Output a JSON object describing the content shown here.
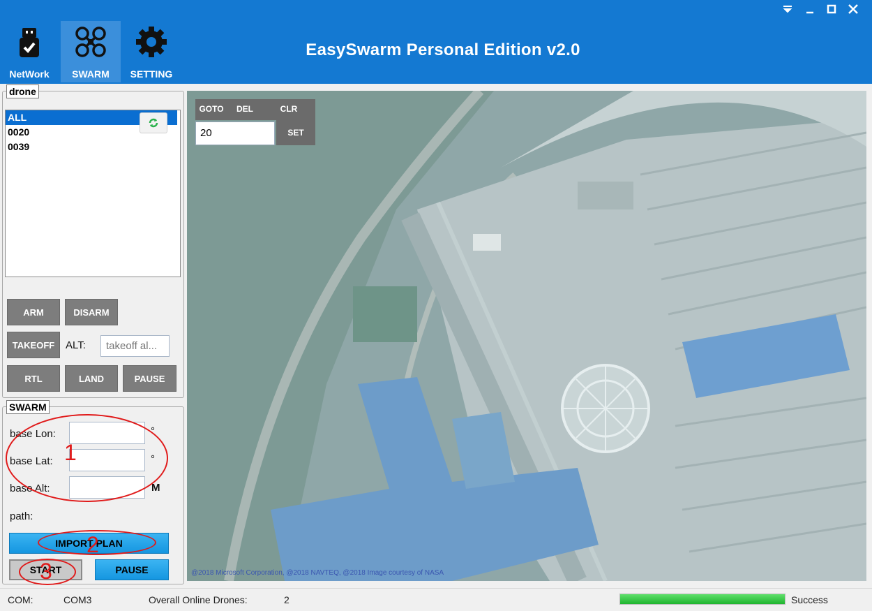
{
  "header": {
    "title": "EasySwarm Personal Edition v2.0",
    "nav": [
      {
        "label": "NetWork",
        "icon": "usb-drive-icon"
      },
      {
        "label": "SWARM",
        "icon": "drone-icon",
        "active": true
      },
      {
        "label": "SETTING",
        "icon": "gear-icon"
      }
    ],
    "window_controls": [
      "dropdown-icon",
      "minimize-icon",
      "maximize-icon",
      "close-icon"
    ],
    "bg_color": "#1479d2"
  },
  "drone_panel": {
    "title": "drone",
    "list": [
      "ALL",
      "0020",
      "0039"
    ],
    "selected_index": 0,
    "refresh_icon": "refresh-icon",
    "arm_label": "ARM",
    "disarm_label": "DISARM",
    "takeoff_label": "TAKEOFF",
    "alt_label": "ALT:",
    "alt_placeholder": "takeoff al...",
    "rtl_label": "RTL",
    "land_label": "LAND",
    "pause_label": "PAUSE"
  },
  "swarm_panel": {
    "title": "SWARM",
    "base_lon_label": "base Lon:",
    "base_lat_label": "base Lat:",
    "base_alt_label": "base Alt:",
    "degree_unit": "°",
    "meter_unit": "M",
    "path_label": "path:",
    "import_label": "IMPORT PLAN",
    "start_label": "START",
    "pause_label": "PAUSE"
  },
  "annotations": [
    "1",
    "2",
    "3"
  ],
  "map": {
    "goto_label": "GOTO",
    "del_label": "DEL",
    "clr_label": "CLR",
    "goto_value": "20",
    "set_label": "SET",
    "copyright": "@2018 Microsoft Corporation, @2018 NAVTEQ, @2018 Image courtesy of NASA"
  },
  "status": {
    "com_label": "COM:",
    "com_value": "COM3",
    "online_label": "Overall Online Drones:",
    "online_value": "2",
    "progress_fraction": 1.0,
    "status_text": "Success"
  }
}
